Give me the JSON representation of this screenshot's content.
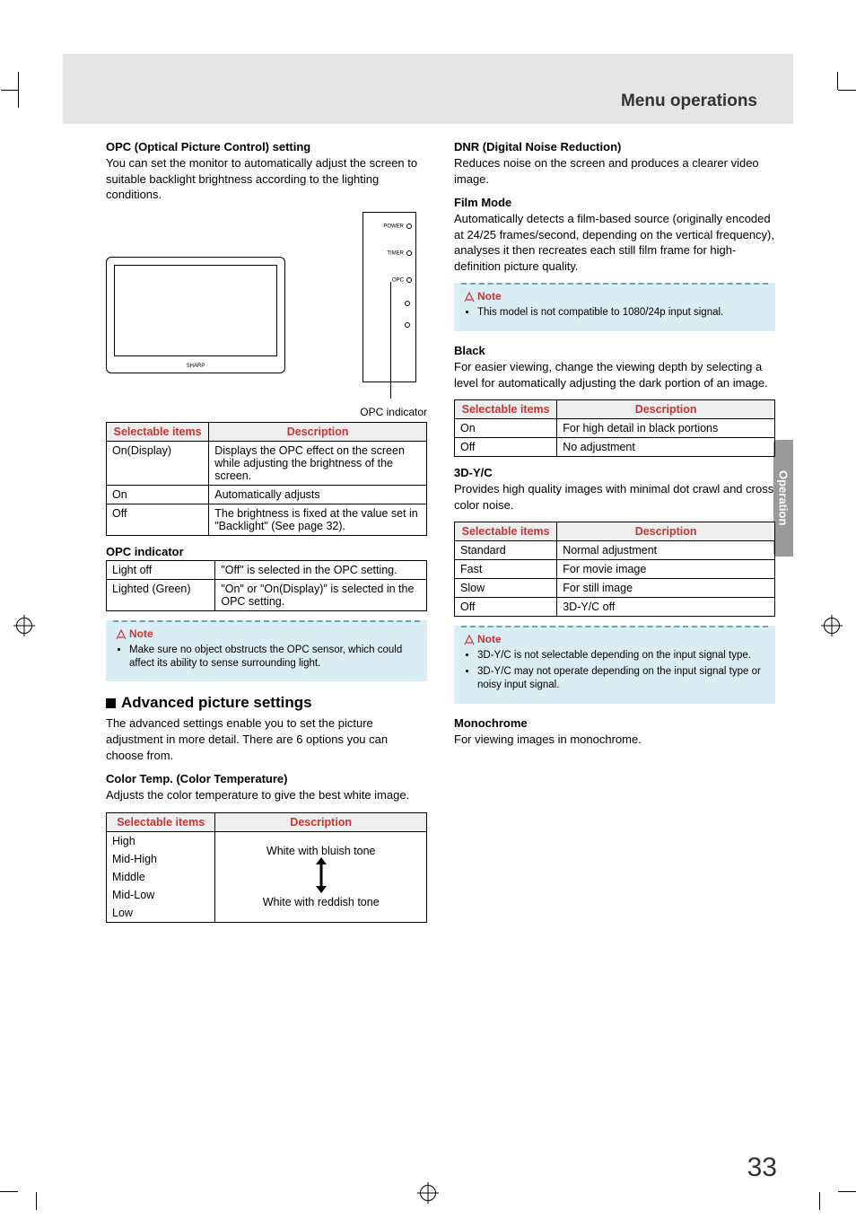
{
  "header": {
    "title": "Menu operations"
  },
  "side_tab": "Operation",
  "page_number": "33",
  "left": {
    "opc_heading": "OPC (Optical Picture Control) setting",
    "opc_body": "You can set the monitor to automatically adjust the screen to suitable backlight brightness according to the lighting conditions.",
    "fig": {
      "power": "POWER",
      "timer": "TIMER",
      "opc": "OPC",
      "caption": "OPC indicator"
    },
    "table1_h1": "Selectable items",
    "table1_h2": "Description",
    "table1": [
      {
        "k": "On(Display)",
        "v": "Displays the OPC effect on the screen while adjusting the brightness of the screen."
      },
      {
        "k": "On",
        "v": "Automatically adjusts"
      },
      {
        "k": "Off",
        "v": "The brightness is fixed at the value set in \"Backlight\" (See page 32)."
      }
    ],
    "opc_ind_heading": "OPC indicator",
    "table2": [
      {
        "k": "Light off",
        "v": "\"Off\" is selected in the OPC setting."
      },
      {
        "k": "Lighted (Green)",
        "v": "\"On\" or \"On(Display)\" is selected in the OPC setting."
      }
    ],
    "note_label": "Note",
    "note_items": [
      "Make sure no object obstructs the OPC sensor, which could affect its ability to sense surrounding light."
    ],
    "adv_heading": "Advanced picture settings",
    "adv_body": "The advanced settings enable you to set the picture adjustment in more detail. There are 6 options you can choose from.",
    "ct_heading": "Color Temp. (Color Temperature)",
    "ct_body": "Adjusts the color temperature to give the best white image.",
    "ct_h1": "Selectable items",
    "ct_h2": "Description",
    "ct_items": [
      "High",
      "Mid-High",
      "Middle",
      "Mid-Low",
      "Low"
    ],
    "ct_top": "White with bluish tone",
    "ct_bottom": "White with reddish tone"
  },
  "right": {
    "dnr_heading": "DNR (Digital Noise Reduction)",
    "dnr_body": "Reduces noise on the screen and produces a clearer video image.",
    "film_heading": "Film Mode",
    "film_body": "Automatically detects a film-based source (originally encoded at 24/25 frames/second, depending on the vertical frequency), analyses it then recreates each still film frame for high-definition picture quality.",
    "note1_label": "Note",
    "note1_items": [
      "This model is not compatible to 1080/24p input signal."
    ],
    "black_heading": "Black",
    "black_body": "For easier viewing, change the viewing depth by selecting a level for automatically adjusting the dark portion of an image.",
    "black_h1": "Selectable items",
    "black_h2": "Description",
    "black_table": [
      {
        "k": "On",
        "v": "For high detail in black portions"
      },
      {
        "k": "Off",
        "v": "No adjustment"
      }
    ],
    "yc_heading": "3D-Y/C",
    "yc_body": "Provides high quality images with minimal dot crawl and cross color noise.",
    "yc_h1": "Selectable items",
    "yc_h2": "Description",
    "yc_table": [
      {
        "k": "Standard",
        "v": "Normal adjustment"
      },
      {
        "k": "Fast",
        "v": "For movie image"
      },
      {
        "k": "Slow",
        "v": "For still image"
      },
      {
        "k": "Off",
        "v": "3D-Y/C off"
      }
    ],
    "note2_label": "Note",
    "note2_items": [
      "3D-Y/C is not selectable depending on the input signal type.",
      "3D-Y/C may not operate depending on the input signal type or noisy input signal."
    ],
    "mono_heading": "Monochrome",
    "mono_body": "For viewing images in monochrome."
  }
}
